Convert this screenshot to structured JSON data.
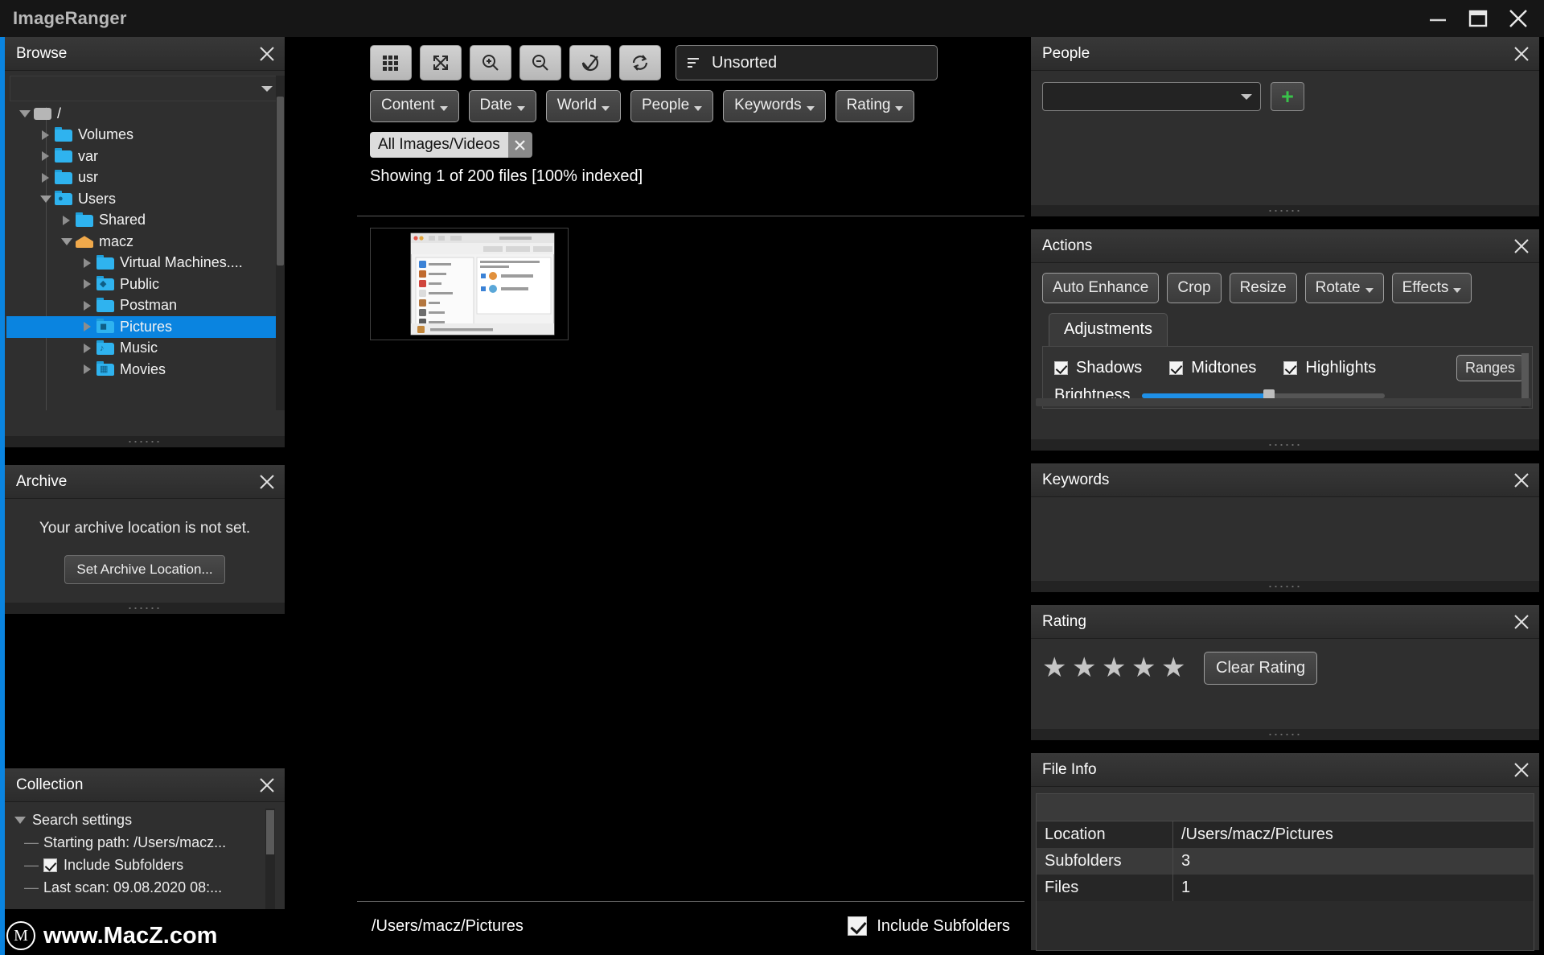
{
  "window": {
    "title": "ImageRanger",
    "controls": [
      "minimize-icon",
      "maximize-icon",
      "close-icon"
    ]
  },
  "browse": {
    "title": "Browse",
    "tree": [
      {
        "label": "/",
        "depth": 0,
        "state": "open",
        "icon": "disk-icon",
        "selected": false
      },
      {
        "label": "Volumes",
        "depth": 1,
        "state": "closed",
        "icon": "folder-icon",
        "selected": false
      },
      {
        "label": "var",
        "depth": 1,
        "state": "closed",
        "icon": "folder-icon",
        "selected": false
      },
      {
        "label": "usr",
        "depth": 1,
        "state": "closed",
        "icon": "folder-icon",
        "selected": false
      },
      {
        "label": "Users",
        "depth": 1,
        "state": "open",
        "icon": "users-folder-icon",
        "selected": false
      },
      {
        "label": "Shared",
        "depth": 2,
        "state": "closed",
        "icon": "folder-icon",
        "selected": false
      },
      {
        "label": "macz",
        "depth": 2,
        "state": "open",
        "icon": "home-icon",
        "selected": false
      },
      {
        "label": "Virtual Machines....",
        "depth": 3,
        "state": "closed",
        "icon": "folder-icon",
        "selected": false
      },
      {
        "label": "Public",
        "depth": 3,
        "state": "closed",
        "icon": "public-folder-icon",
        "selected": false
      },
      {
        "label": "Postman",
        "depth": 3,
        "state": "closed",
        "icon": "folder-icon",
        "selected": false
      },
      {
        "label": "Pictures",
        "depth": 3,
        "state": "closed",
        "icon": "pictures-folder-icon",
        "selected": true
      },
      {
        "label": "Music",
        "depth": 3,
        "state": "closed",
        "icon": "music-folder-icon",
        "selected": false
      },
      {
        "label": "Movies",
        "depth": 3,
        "state": "closed",
        "icon": "movies-folder-icon",
        "selected": false
      }
    ]
  },
  "archive": {
    "title": "Archive",
    "message": "Your archive location is not set.",
    "button": "Set Archive Location..."
  },
  "collection": {
    "title": "Collection",
    "root": "Search settings",
    "items": [
      {
        "text": "Starting path: /Users/macz...",
        "checkbox": null
      },
      {
        "text": "Include Subfolders",
        "checkbox": true
      },
      {
        "text": "Last scan: 09.08.2020 08:...",
        "checkbox": null
      }
    ]
  },
  "center": {
    "toolbar_icons": [
      "grid-view-icon",
      "fullscreen-icon",
      "zoom-in-icon",
      "zoom-out-icon",
      "check-icon",
      "refresh-icon"
    ],
    "sort": {
      "icon": "sort-icon",
      "value": "Unsorted"
    },
    "filters": [
      {
        "label": "Content"
      },
      {
        "label": "Date"
      },
      {
        "label": "World"
      },
      {
        "label": "People"
      },
      {
        "label": "Keywords"
      },
      {
        "label": "Rating"
      }
    ],
    "chip": {
      "label": "All Images/Videos",
      "remove_icon": "close-icon"
    },
    "showing": "Showing 1 of 200 files [100% indexed]",
    "status": {
      "path": "/Users/macz/Pictures",
      "include_subfolders_label": "Include Subfolders",
      "include_subfolders_checked": true
    }
  },
  "people": {
    "title": "People",
    "combo_value": "",
    "add_icon": "plus-icon"
  },
  "actions": {
    "title": "Actions",
    "buttons": [
      {
        "label": "Auto Enhance",
        "caret": false
      },
      {
        "label": "Crop",
        "caret": false
      },
      {
        "label": "Resize",
        "caret": false
      },
      {
        "label": "Rotate",
        "caret": true
      },
      {
        "label": "Effects",
        "caret": true
      }
    ],
    "tab": "Adjustments",
    "checkboxes": [
      {
        "label": "Shadows",
        "checked": true
      },
      {
        "label": "Midtones",
        "checked": true
      },
      {
        "label": "Highlights",
        "checked": true
      }
    ],
    "ranges_button": "Ranges",
    "slider": {
      "label": "Brightness",
      "percent": 52
    }
  },
  "keywords": {
    "title": "Keywords"
  },
  "rating": {
    "title": "Rating",
    "stars": 5,
    "filled": 0,
    "clear_button": "Clear Rating"
  },
  "file_info": {
    "title": "File Info",
    "rows": [
      {
        "key": "Location",
        "value": "/Users/macz/Pictures"
      },
      {
        "key": "Subfolders",
        "value": "3"
      },
      {
        "key": "Files",
        "value": "1"
      }
    ]
  },
  "watermark": {
    "mark": "M",
    "text": "www.MacZ.com"
  },
  "colors": {
    "accent": "#0a84e0",
    "panel_bg": "#2f2f2f",
    "header_bg": "#383838",
    "canvas_bg": "#000000",
    "slider_fill": "#1e90e8",
    "plus_green": "#39c24a"
  }
}
